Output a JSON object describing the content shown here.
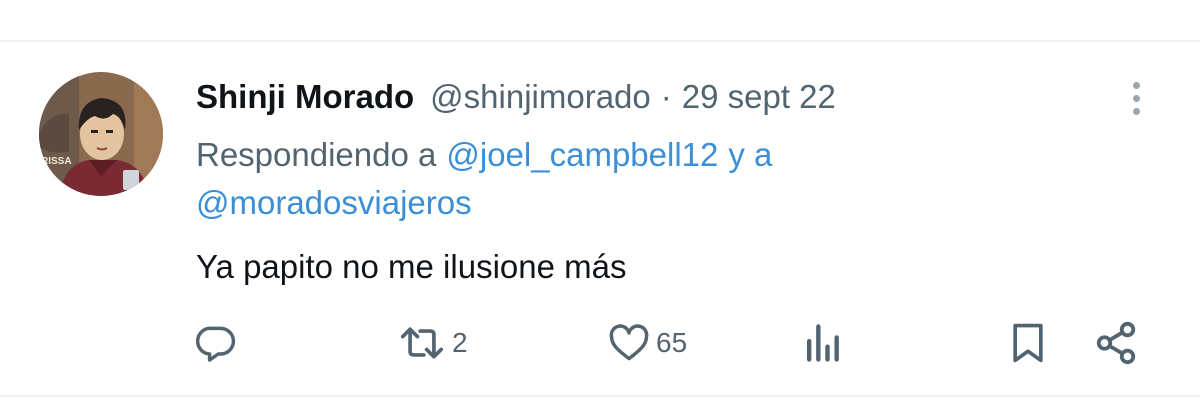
{
  "tweet": {
    "author_name": "Shinji Morado",
    "handle": "@shinjimorado",
    "separator": "·",
    "date": "29 sept 22",
    "replying_prefix": "Respondiendo a",
    "mention_1": "@joel_campbell12",
    "and_word": "y a",
    "mention_2": "@moradosviajeros",
    "text": "Ya papito no me ilusione más"
  },
  "actions": {
    "reply_icon": "reply-icon",
    "retweet_icon": "retweet-icon",
    "retweet_count": "2",
    "like_icon": "heart-icon",
    "like_count": "65",
    "analytics_icon": "analytics-icon",
    "bookmark_icon": "bookmark-icon",
    "share_icon": "share-icon"
  },
  "colors": {
    "text_primary": "#0f1419",
    "text_secondary": "#536471",
    "link": "#3c8fd6",
    "icon": "#536471",
    "divider": "#eff3f4"
  },
  "avatar": {
    "badge_text": "RISSA"
  }
}
